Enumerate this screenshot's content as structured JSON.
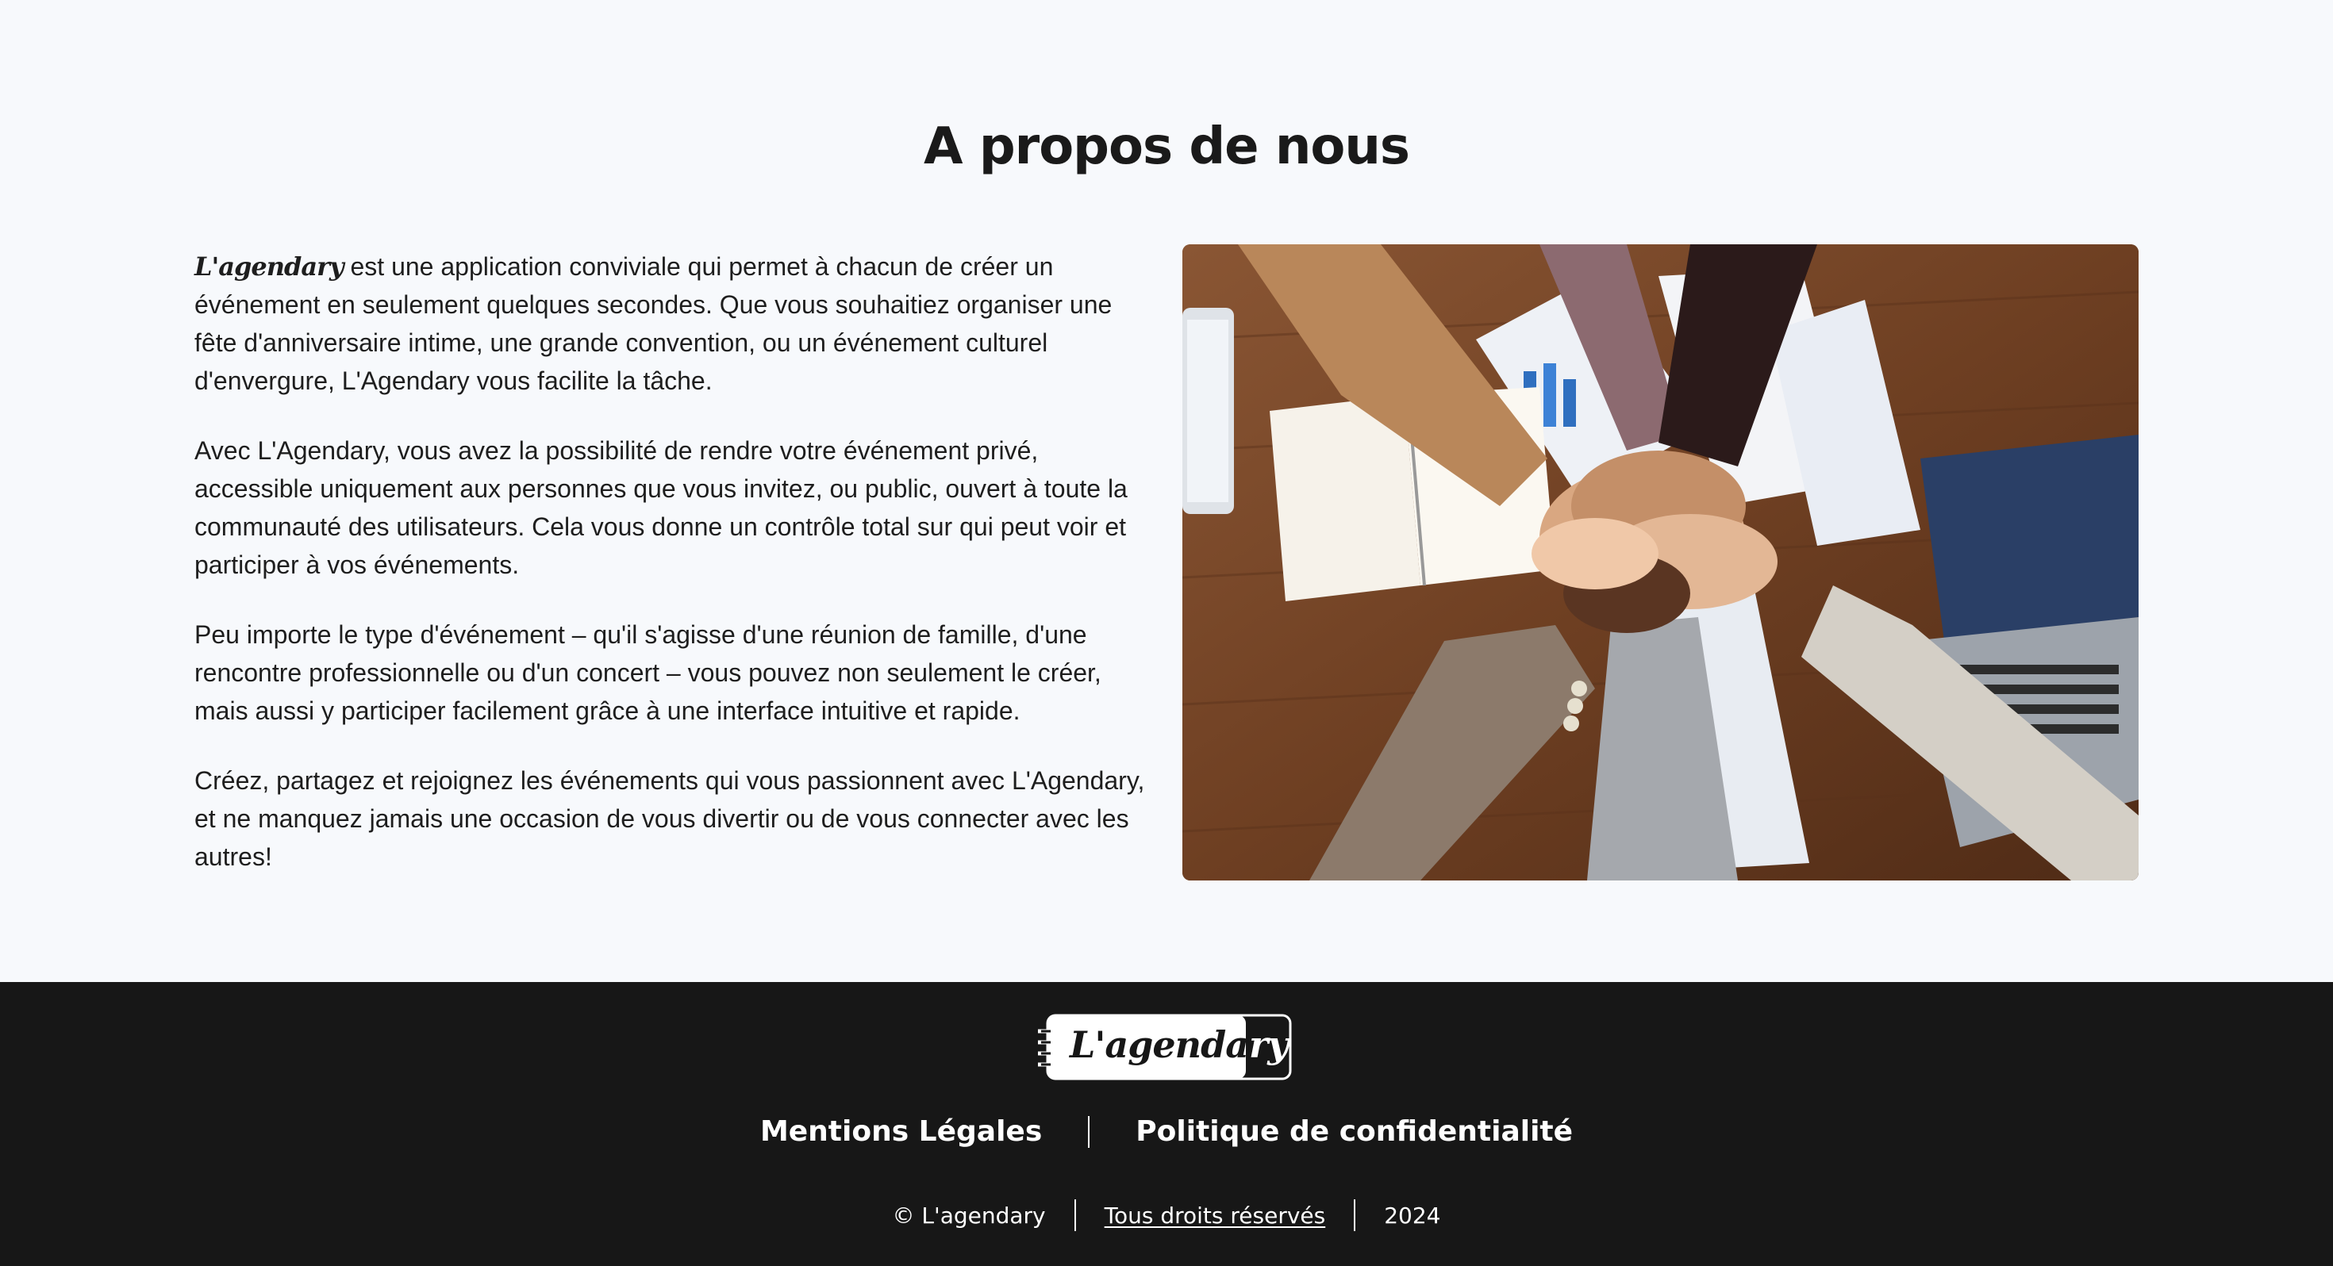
{
  "about": {
    "title": "A propos de nous",
    "brand_inline": "L'agendary",
    "p1_rest": " est une application conviviale qui permet à chacun de créer un événement en seulement quelques secondes. Que vous souhaitiez organiser une fête d'anniversaire intime, une grande convention, ou un événement culturel d'envergure, L'Agendary vous facilite la tâche.",
    "p2": "Avec L'Agendary, vous avez la possibilité de rendre votre événement privé, accessible uniquement aux personnes que vous invitez, ou public, ouvert à toute la communauté des utilisateurs. Cela vous donne un contrôle total sur qui peut voir et participer à vos événements.",
    "p3": "Peu importe le type d'événement – qu'il s'agisse d'une réunion de famille, d'une rencontre professionnelle ou d'un concert – vous pouvez non seulement le créer, mais aussi y participer facilement grâce à une interface intuitive et rapide.",
    "p4": "Créez, partagez et rejoignez les événements qui vous passionnent avec L'Agendary, et ne manquez jamais une occasion de vous divertir ou de vous connecter avec les autres!"
  },
  "footer": {
    "logo_text_main": "L'agenda",
    "logo_text_tail": "ry",
    "link_legal": "Mentions Légales",
    "link_privacy": "Politique de confidentialité",
    "copyright": "© L'agendary",
    "rights": "Tous droits réservés",
    "year": "2024"
  },
  "colors": {
    "page_bg": "#f7f9fc",
    "footer_bg": "#171717",
    "text": "#1e1e1e"
  }
}
